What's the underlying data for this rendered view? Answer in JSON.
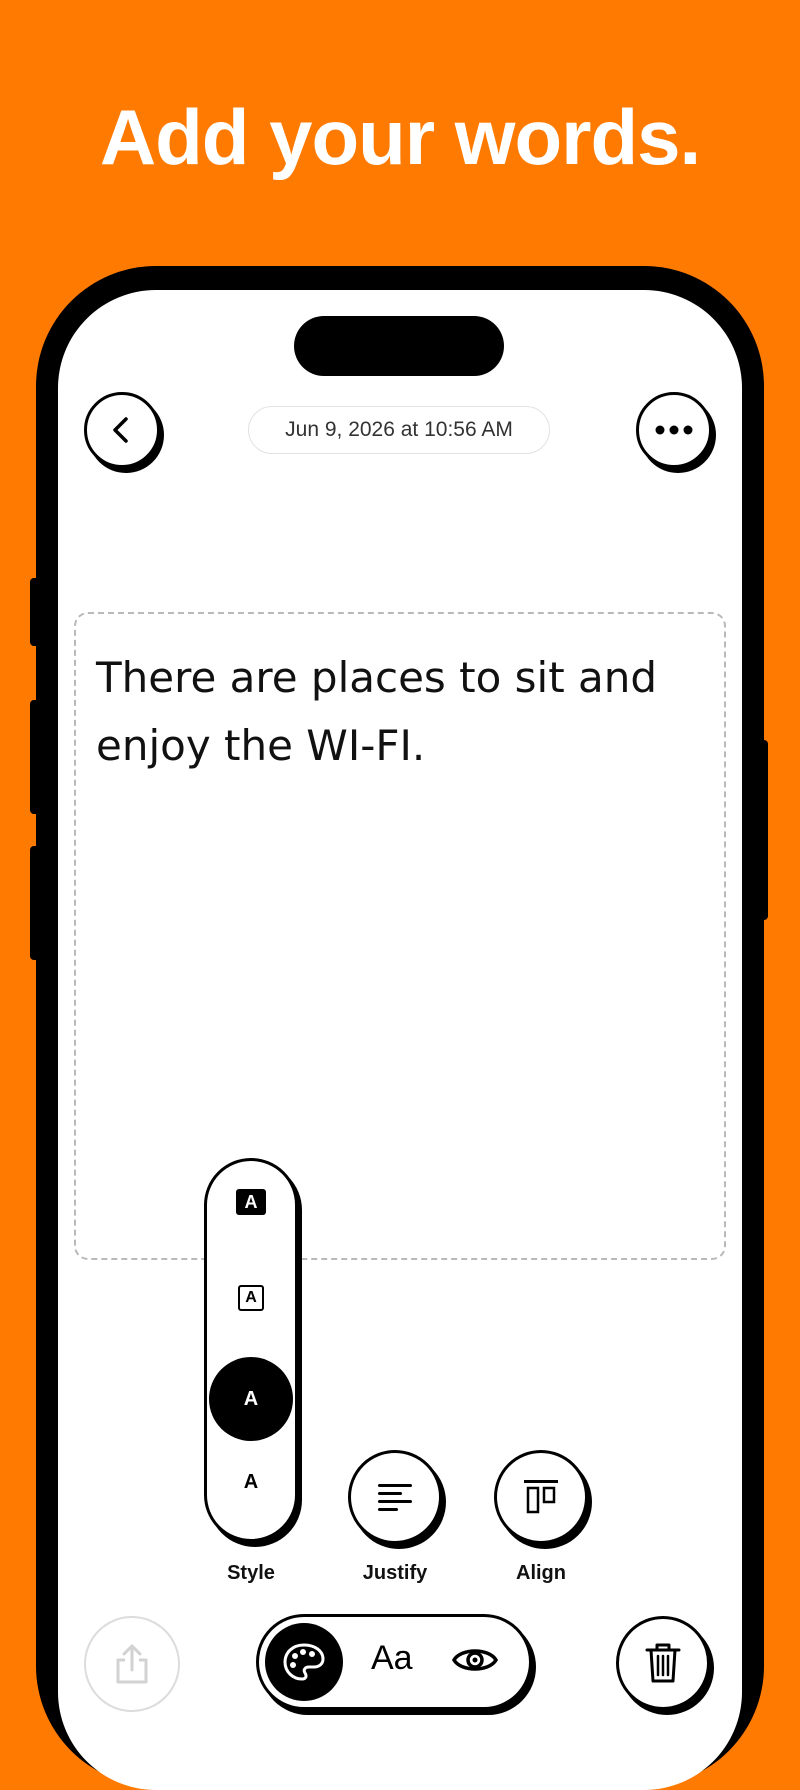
{
  "headline": "Add your words.",
  "header": {
    "date": "Jun 9, 2026 at 10:56 AM",
    "back_icon": "chevron-left-icon",
    "more_icon": "ellipsis-icon"
  },
  "note": {
    "text": "There are places to sit and enjoy the WI-FI."
  },
  "style_menu": {
    "options": [
      {
        "label": "A",
        "variant": "filled-square"
      },
      {
        "label": "A",
        "variant": "outlined-square"
      },
      {
        "label": "A",
        "variant": "filled-circle",
        "selected": true
      },
      {
        "label": "A",
        "variant": "plain"
      }
    ]
  },
  "tools": {
    "style_label": "Style",
    "justify_label": "Justify",
    "align_label": "Align"
  },
  "bottom_bar": {
    "share_icon": "share-icon",
    "palette_icon": "palette-icon",
    "font_label": "Aa",
    "eye_icon": "eye-icon",
    "trash_icon": "trash-icon"
  },
  "colors": {
    "background": "#FF7A00",
    "ink": "#000000",
    "screen": "#FFFFFF"
  }
}
